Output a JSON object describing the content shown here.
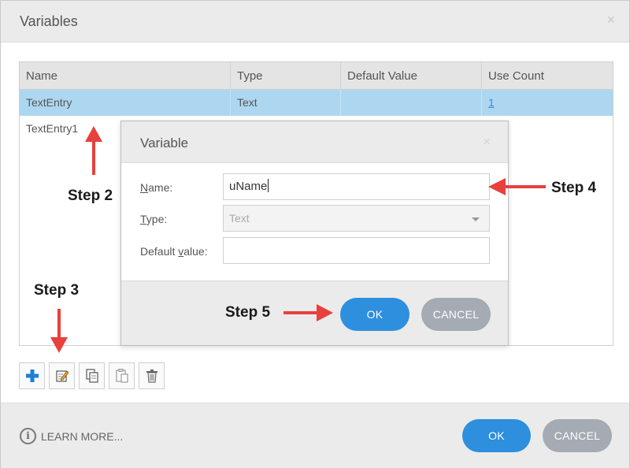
{
  "outer_dialog": {
    "title": "Variables",
    "close_glyph": "×"
  },
  "table": {
    "columns": [
      "Name",
      "Type",
      "Default Value",
      "Use Count"
    ],
    "rows": [
      {
        "name": "TextEntry",
        "type": "Text",
        "default_value": "",
        "use_count": "1",
        "selected": true
      },
      {
        "name": "TextEntry1",
        "type": "",
        "default_value": "",
        "use_count": "",
        "selected": false
      }
    ]
  },
  "toolbar": {
    "buttons": [
      {
        "icon": "add-icon"
      },
      {
        "icon": "edit-icon"
      },
      {
        "icon": "copy-icon"
      },
      {
        "icon": "paste-icon"
      },
      {
        "icon": "delete-icon"
      }
    ]
  },
  "footer": {
    "info_glyph": "i",
    "learn_more": "LEARN MORE...",
    "ok": "OK",
    "cancel": "CANCEL"
  },
  "variable_dialog": {
    "title": "Variable",
    "close_glyph": "×",
    "name_label_pre": "",
    "name_label_key": "N",
    "name_label_post": "ame:",
    "name_value": "uName",
    "type_label_key": "T",
    "type_label_post": "ype:",
    "type_value": "Text",
    "default_label_pre": "Default ",
    "default_label_key": "v",
    "default_label_post": "alue:",
    "default_value": "",
    "ok": "OK",
    "cancel": "CANCEL"
  },
  "annotations": {
    "step2": "Step 2",
    "step3": "Step 3",
    "step4": "Step 4",
    "step5": "Step 5",
    "arrow_color": "#e8403c"
  },
  "colors": {
    "accent": "#2d8fde",
    "selected_row": "#add7f0",
    "cancel_button": "#a4abb2"
  }
}
